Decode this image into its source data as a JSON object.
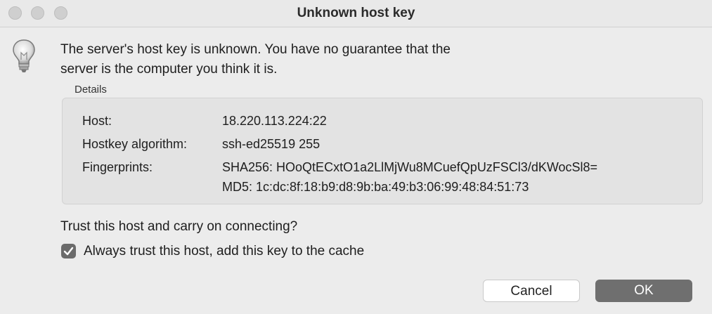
{
  "window": {
    "title": "Unknown host key"
  },
  "icons": {
    "alert": "lightbulb-icon"
  },
  "message": {
    "line1": "The server's host key is unknown. You have no guarantee that the",
    "line2": "server is the computer you think it is."
  },
  "details": {
    "label": "Details",
    "host_label": "Host:",
    "host_value": "18.220.113.224:22",
    "algorithm_label": "Hostkey algorithm:",
    "algorithm_value": "ssh-ed25519 255",
    "fingerprints_label": "Fingerprints:",
    "fingerprint_sha256": "SHA256: HOoQtECxtO1a2LlMjWu8MCuefQpUzFSCl3/dKWocSl8=",
    "fingerprint_md5": "MD5: 1c:dc:8f:18:b9:d8:9b:ba:49:b3:06:99:48:84:51:73"
  },
  "prompt": {
    "question": "Trust this host and carry on connecting?",
    "checkbox_label": "Always trust this host, add this key to the cache",
    "checkbox_checked": true
  },
  "buttons": {
    "cancel": "Cancel",
    "ok": "OK"
  }
}
